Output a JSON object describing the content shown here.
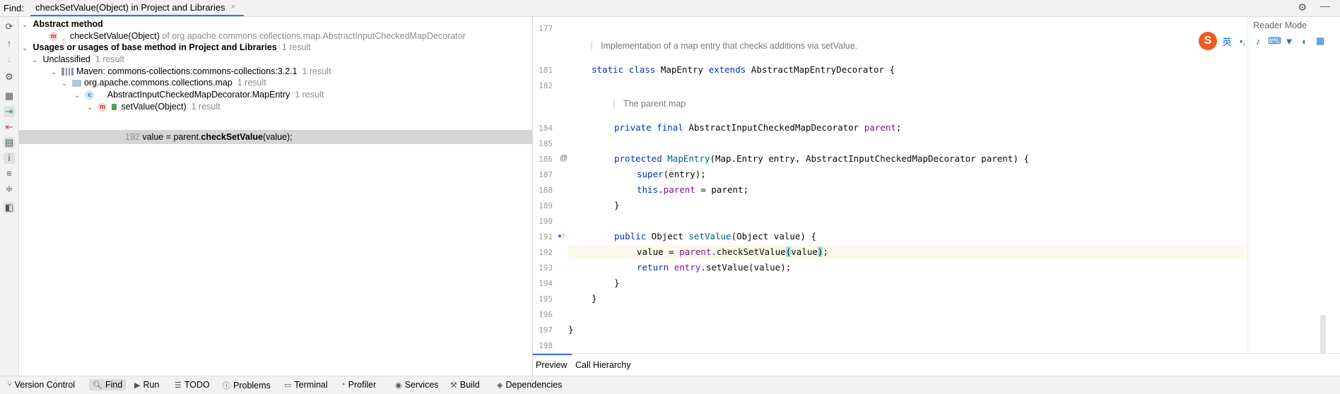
{
  "find": {
    "label": "Find:",
    "tab_title": "checkSetValue(Object) in Project and Libraries",
    "tab_close": "×"
  },
  "tree": {
    "abstract_header": "Abstract method",
    "abstract_item_name": "checkSetValue(Object)",
    "abstract_item_of": "of org.apache.commons.collections.map.AbstractInputCheckedMapDecorator",
    "usages_header": "Usages or usages of base method in Project and Libraries",
    "usages_count": "1 result",
    "unclassified": "Unclassified",
    "unclassified_count": "1 result",
    "maven": "Maven: commons-collections:commons-collections:3.2.1",
    "maven_count": "1 result",
    "package": "org.apache.commons.collections.map",
    "package_count": "1 result",
    "class": "AbstractInputCheckedMapDecorator.MapEntry",
    "class_count": "1 result",
    "method": "setValue(Object)",
    "method_count": "1 result",
    "usage_line": "192",
    "usage_pre": "value = parent.",
    "usage_bold": "checkSetValue",
    "usage_post": "(value);"
  },
  "editor": {
    "reader_mode": "Reader Mode",
    "doc_entry": "Implementation of a map entry that checks additions via setValue.",
    "doc_parent": "The parent map",
    "lines": {
      "l177": "177",
      "l181": "181",
      "l182": "182",
      "l184": "184",
      "l185": "185",
      "l186": "186",
      "l187": "187",
      "l188": "188",
      "l189": "189",
      "l190": "190",
      "l191": "191",
      "l192": "192",
      "l193": "193",
      "l194": "194",
      "l195": "195",
      "l196": "196",
      "l197": "197",
      "l198": "198"
    },
    "gutter_at": "@"
  },
  "ime": {
    "logo": "S",
    "lang": "英"
  },
  "preview_tabs": [
    "Preview",
    "Call Hierarchy"
  ],
  "bottom_bar": [
    "Version Control",
    "Find",
    "Run",
    "TODO",
    "Problems",
    "Terminal",
    "Profiler",
    "Services",
    "Build",
    "Dependencies"
  ],
  "colors": {
    "accent": "#3574f0",
    "keyword": "#0033b3",
    "field": "#871094",
    "method": "#00627a"
  }
}
